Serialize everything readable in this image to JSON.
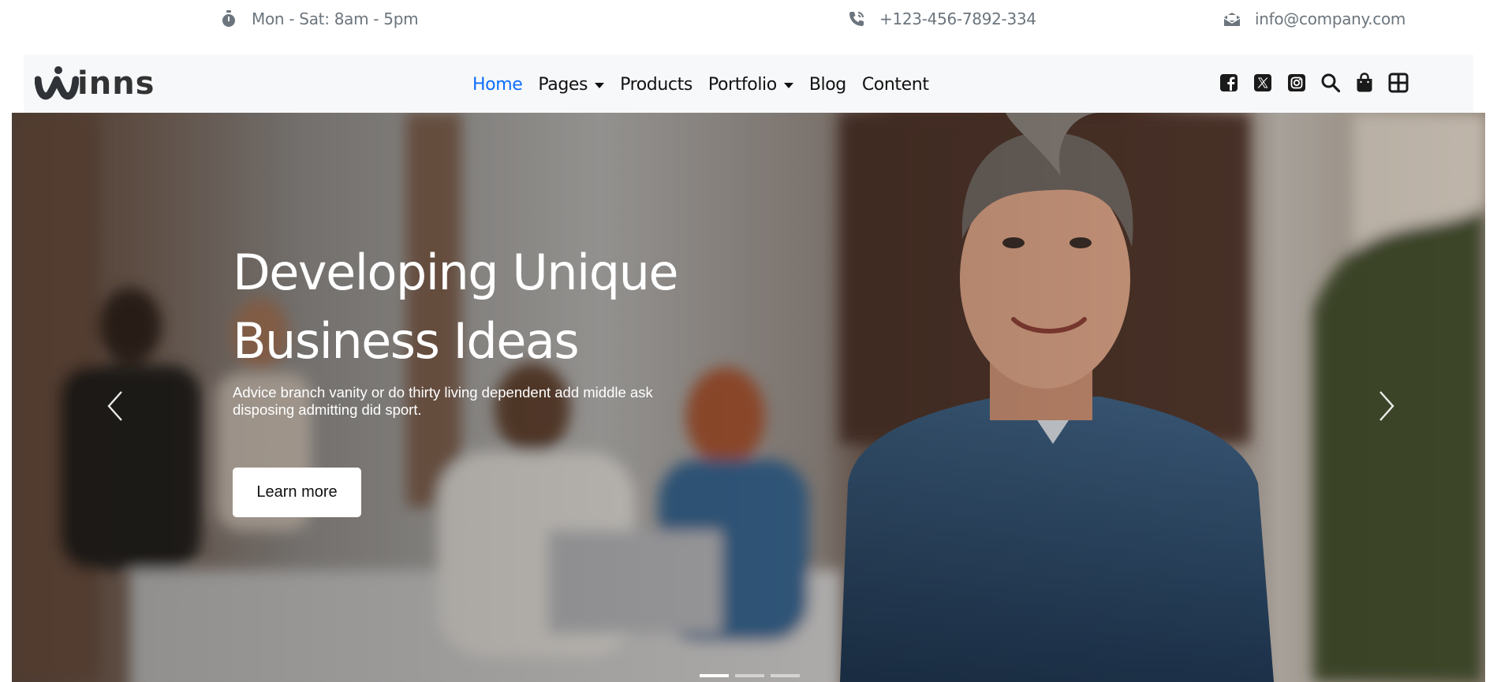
{
  "topbar": {
    "hours": {
      "icon": "stopwatch-icon",
      "text": "Mon - Sat: 8am - 5pm"
    },
    "phone": {
      "icon": "phone-icon",
      "text": "+123-456-7892-334"
    },
    "email": {
      "icon": "envelope-icon",
      "text": "info@company.com"
    }
  },
  "navbar": {
    "logo_text": "inns",
    "menu": [
      {
        "label": "Home",
        "active": true
      },
      {
        "label": "Pages",
        "dropdown": true
      },
      {
        "label": "Products"
      },
      {
        "label": "Portfolio",
        "dropdown": true
      },
      {
        "label": "Blog"
      },
      {
        "label": "Content"
      }
    ],
    "icons": [
      "facebook-icon",
      "x-twitter-icon",
      "instagram-icon",
      "search-icon",
      "shopping-bag-icon",
      "grid-icon"
    ]
  },
  "hero": {
    "title_line1": "Developing Unique",
    "title_line2": "Business Ideas",
    "text": "Advice branch vanity or do thirty living dependent add middle ask disposing admitting did sport.",
    "button_label": "Learn more",
    "slides": 3,
    "active_slide": 1
  },
  "colors": {
    "accent": "#0d6efd",
    "navbar_bg": "#f7f8fa",
    "info_text": "#6c757d"
  }
}
